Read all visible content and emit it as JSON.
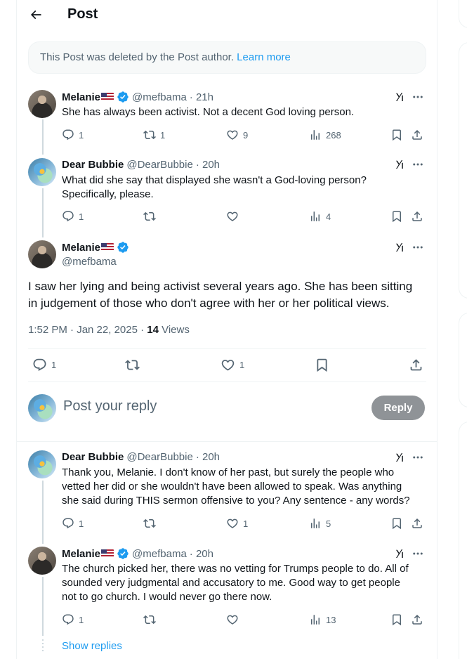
{
  "header": {
    "title": "Post"
  },
  "deleted_notice": {
    "text": "This Post was deleted by the Post author.",
    "link": "Learn more"
  },
  "tweets": [
    {
      "name": "Melanie",
      "handle": "@mefbama",
      "time": "· 21h",
      "text": "She has always been activist. Not a decent God loving person.",
      "replies": "1",
      "reposts": "1",
      "likes": "9",
      "views": "268"
    },
    {
      "name": "Dear Bubbie",
      "handle": "@DearBubbie",
      "time": "· 20h",
      "text_lines": [
        "What did she say that displayed she wasn't a  God-loving person?",
        "Specifically, please."
      ],
      "replies": "1",
      "reposts": "",
      "likes": "",
      "views": "4"
    }
  ],
  "focused": {
    "name": "Melanie",
    "handle": "@mefbama",
    "text_lines": [
      "I saw her lying and being activist several years ago. She has been sitting",
      "in judgement of those who don't agree with her or her political views."
    ],
    "time": "1:52 PM · Jan 22, 2025 · ",
    "views_count": "14",
    "views_label": " Views",
    "replies": "1",
    "likes": "1"
  },
  "compose": {
    "placeholder": "Post your reply",
    "button": "Reply"
  },
  "replies": [
    {
      "name": "Dear Bubbie",
      "handle": "@DearBubbie",
      "time": "· 20h",
      "text_lines": [
        "Thank you, Melanie. I don't know of her past, but surely the people who",
        "vetted her did or she wouldn't have been allowed to speak. Was anything",
        "she said during THIS sermon offensive to you? Any sentence - any words?"
      ],
      "replies": "1",
      "reposts": "",
      "likes": "1",
      "views": "5"
    },
    {
      "name": "Melanie",
      "handle": "@mefbama",
      "time": "· 20h",
      "text_lines": [
        "The church picked her, there was no vetting for Trumps people to do. All of",
        "sounded very judgmental and accusatory to me. Good way to get people",
        "not to go church. I would never go there now."
      ],
      "replies": "1",
      "reposts": "",
      "likes": "",
      "views": "13"
    }
  ],
  "show_replies": "Show replies",
  "colors": {
    "accent": "#1d9bf0",
    "text": "#0f1419",
    "muted": "#536471",
    "border": "#eff3f4"
  }
}
